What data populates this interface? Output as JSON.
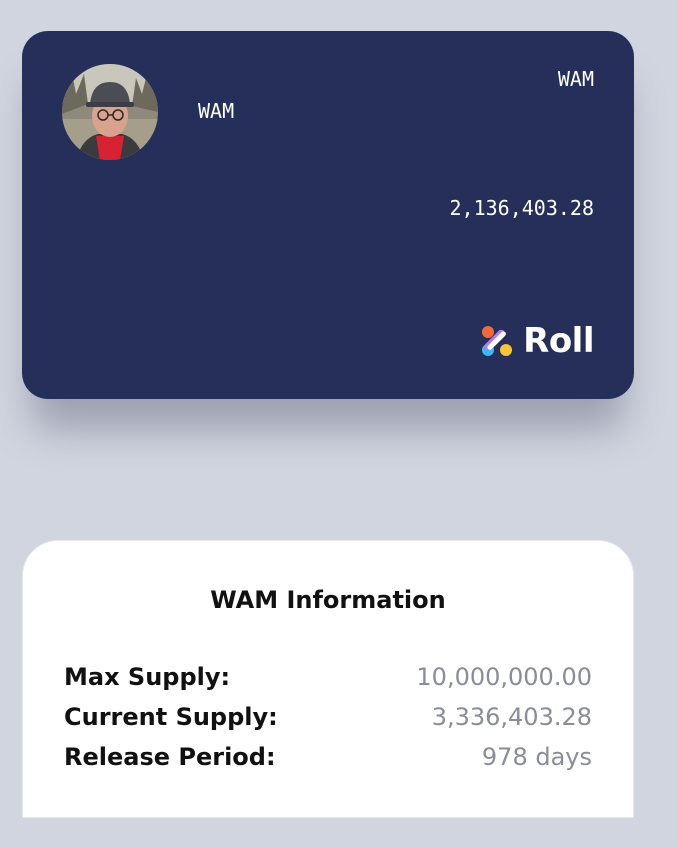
{
  "card": {
    "name": "WAM",
    "symbol": "WAM",
    "balance": "2,136,403.28",
    "brand": "Roll",
    "background_color": "#252f59"
  },
  "info": {
    "title": "WAM Information",
    "rows": [
      {
        "label": "Max Supply:",
        "value": "10,000,000.00"
      },
      {
        "label": "Current Supply:",
        "value": "3,336,403.28"
      },
      {
        "label": "Release Period:",
        "value": "978 days"
      }
    ]
  },
  "icons": {
    "avatar": "user-avatar-photo",
    "brand_logo": "roll-logo-icon"
  }
}
